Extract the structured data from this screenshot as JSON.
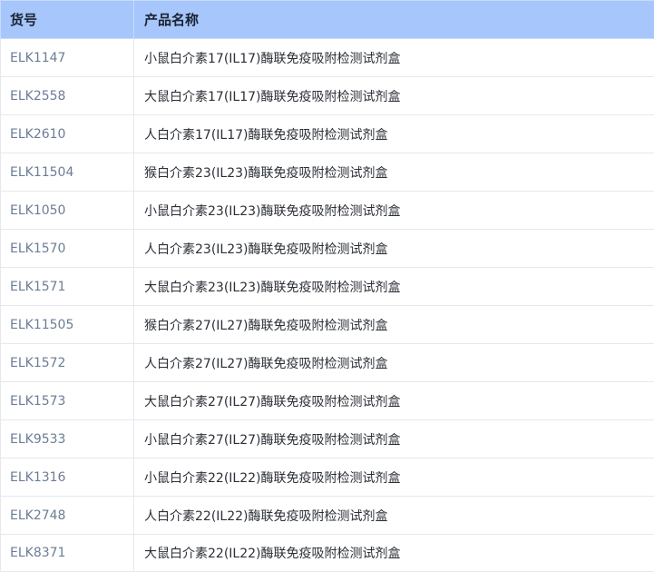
{
  "table": {
    "headers": {
      "code": "货号",
      "name": "产品名称"
    },
    "rows": [
      {
        "code": "ELK1147",
        "name": "小鼠白介素17(IL17)酶联免疫吸附检测试剂盒"
      },
      {
        "code": "ELK2558",
        "name": "大鼠白介素17(IL17)酶联免疫吸附检测试剂盒"
      },
      {
        "code": "ELK2610",
        "name": "人白介素17(IL17)酶联免疫吸附检测试剂盒"
      },
      {
        "code": "ELK11504",
        "name": "猴白介素23(IL23)酶联免疫吸附检测试剂盒"
      },
      {
        "code": "ELK1050",
        "name": "小鼠白介素23(IL23)酶联免疫吸附检测试剂盒"
      },
      {
        "code": "ELK1570",
        "name": "人白介素23(IL23)酶联免疫吸附检测试剂盒"
      },
      {
        "code": "ELK1571",
        "name": "大鼠白介素23(IL23)酶联免疫吸附检测试剂盒"
      },
      {
        "code": "ELK11505",
        "name": "猴白介素27(IL27)酶联免疫吸附检测试剂盒"
      },
      {
        "code": "ELK1572",
        "name": "人白介素27(IL27)酶联免疫吸附检测试剂盒"
      },
      {
        "code": "ELK1573",
        "name": "大鼠白介素27(IL27)酶联免疫吸附检测试剂盒"
      },
      {
        "code": "ELK9533",
        "name": "小鼠白介素27(IL27)酶联免疫吸附检测试剂盒"
      },
      {
        "code": "ELK1316",
        "name": "小鼠白介素22(IL22)酶联免疫吸附检测试剂盒"
      },
      {
        "code": "ELK2748",
        "name": "人白介素22(IL22)酶联免疫吸附检测试剂盒"
      },
      {
        "code": "ELK8371",
        "name": "大鼠白介素22(IL22)酶联免疫吸附检测试剂盒"
      }
    ]
  },
  "colors": {
    "header_background": "#a6c6fc",
    "code_text": "#6c7d95",
    "name_text": "#2b2f36",
    "border": "#e4e8ee"
  }
}
